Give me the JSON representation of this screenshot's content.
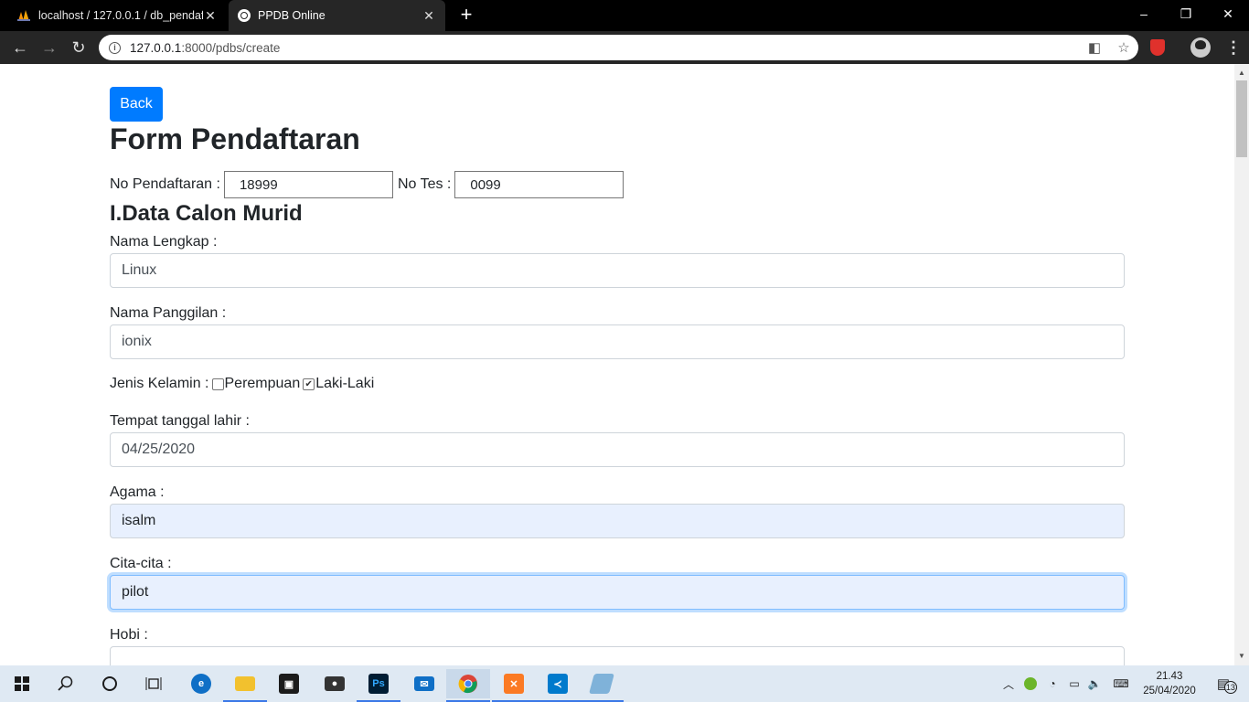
{
  "browser": {
    "tabs": [
      {
        "title": "localhost / 127.0.0.1 / db_pendaf",
        "favicon": "phpmyadmin-icon"
      },
      {
        "title": "PPDB Online",
        "favicon": "globe-icon"
      }
    ],
    "url_host": "127.0.0.1",
    "url_rest": ":8000/pdbs/create"
  },
  "form": {
    "back_label": "Back",
    "title": "Form Pendaftaran",
    "no_pendaftaran_label": "No Pendaftaran :",
    "no_pendaftaran_value": "18999",
    "no_tes_label": "No Tes :",
    "no_tes_value": "0099",
    "section_title": "I.Data Calon Murid",
    "nama_lengkap_label": "Nama Lengkap :",
    "nama_lengkap_value": "Linux",
    "nama_panggilan_label": "Nama Panggilan :",
    "nama_panggilan_value": "ionix",
    "jenis_kelamin_label": "Jenis Kelamin :",
    "gender_options": [
      "Perempuan",
      "Laki-Laki"
    ],
    "gender_checked": "Laki-Laki",
    "ttl_label": "Tempat tanggal lahir :",
    "ttl_value": "04/25/2020",
    "agama_label": "Agama :",
    "agama_value": "isalm",
    "cita_label": "Cita-cita :",
    "cita_value": "pilot",
    "hobi_label": "Hobi :",
    "hobi_value": ""
  },
  "taskbar": {
    "time": "21.43",
    "date": "25/04/2020",
    "notifications": "13"
  },
  "colors": {
    "primary": "#007bff",
    "autofill": "#e8f0fe",
    "taskbar": "#dfe9f3"
  }
}
